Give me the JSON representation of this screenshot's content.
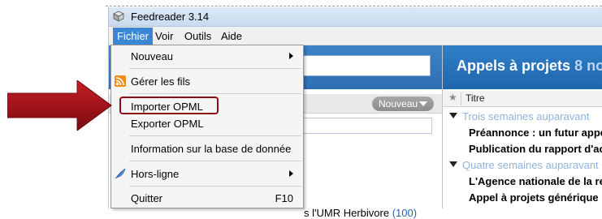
{
  "window": {
    "title": "Feedreader 3.14"
  },
  "menubar": {
    "items": [
      {
        "label": "Fichier",
        "active": true
      },
      {
        "label": "Voir",
        "active": false
      },
      {
        "label": "Outils",
        "active": false
      },
      {
        "label": "Aide",
        "active": false
      }
    ]
  },
  "file_menu": {
    "nouveau": "Nouveau",
    "gerer_fils": "Gérer les fils",
    "importer_opml": "Importer OPML",
    "exporter_opml": "Exporter OPML",
    "information": "Information sur la base de donnée",
    "hors_ligne": "Hors-ligne",
    "quitter": "Quitter",
    "quitter_shortcut": "F10"
  },
  "left_panel": {
    "nouveau_button": "Nouveau",
    "feed_item_label": "s l'UMR Herbivore",
    "feed_item_count": "(100)"
  },
  "right_panel": {
    "title": "Appels à projets",
    "title_count": "8 no",
    "column_title": "Titre",
    "rows": [
      {
        "type": "group",
        "label": "Trois semaines auparavant"
      },
      {
        "type": "entry",
        "label": "Préannonce : un futur appel"
      },
      {
        "type": "entry",
        "label": "Publication du rapport d'act"
      },
      {
        "type": "group",
        "label": "Quatre semaines auparavant"
      },
      {
        "type": "entry",
        "label": "L'Agence nationale de la re"
      },
      {
        "type": "entry",
        "label": "Appel à projets générique"
      }
    ]
  },
  "colors": {
    "accent": "#3c86d6",
    "header_blue": "#2e6fb3",
    "annotation_red": "#8b0f14"
  },
  "icons": {
    "app": "cube-icon",
    "feeds": "rss-icon",
    "offline": "feather-icon",
    "annotation": "red-arrow-icon"
  }
}
